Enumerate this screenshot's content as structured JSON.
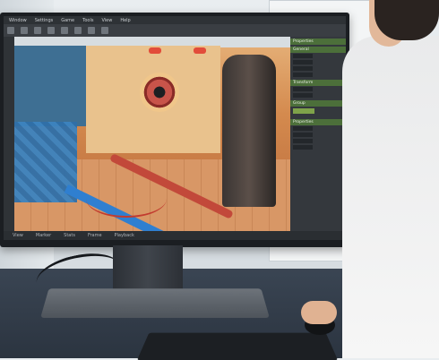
{
  "app": {
    "menu": [
      "Window",
      "Settings",
      "Game",
      "Tools",
      "View",
      "Help"
    ],
    "status_items": [
      "View",
      "Marker",
      "Stats",
      "Frame",
      "Playback"
    ],
    "panel_headers": [
      "Properties",
      "General",
      "Transform",
      "Group",
      "Properties"
    ]
  }
}
